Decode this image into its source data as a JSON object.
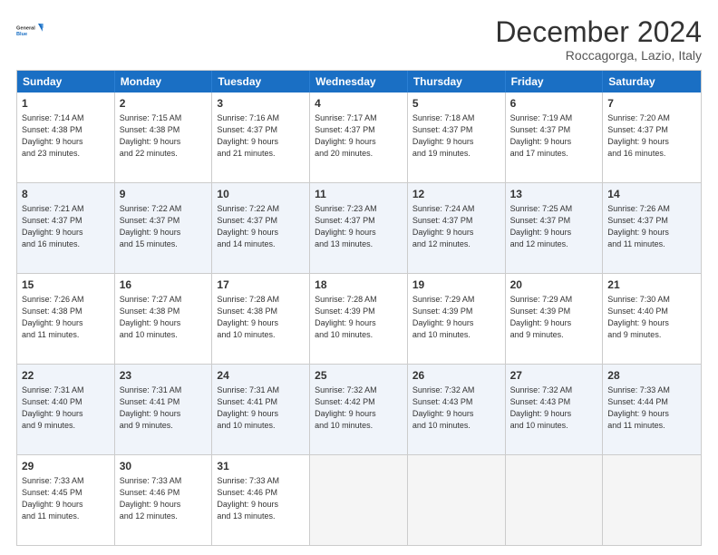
{
  "header": {
    "logo_line1": "General",
    "logo_line2": "Blue",
    "month": "December 2024",
    "location": "Roccagorga, Lazio, Italy"
  },
  "weekdays": [
    "Sunday",
    "Monday",
    "Tuesday",
    "Wednesday",
    "Thursday",
    "Friday",
    "Saturday"
  ],
  "rows": [
    [
      {
        "day": "1",
        "info": "Sunrise: 7:14 AM\nSunset: 4:38 PM\nDaylight: 9 hours\nand 23 minutes."
      },
      {
        "day": "2",
        "info": "Sunrise: 7:15 AM\nSunset: 4:38 PM\nDaylight: 9 hours\nand 22 minutes."
      },
      {
        "day": "3",
        "info": "Sunrise: 7:16 AM\nSunset: 4:37 PM\nDaylight: 9 hours\nand 21 minutes."
      },
      {
        "day": "4",
        "info": "Sunrise: 7:17 AM\nSunset: 4:37 PM\nDaylight: 9 hours\nand 20 minutes."
      },
      {
        "day": "5",
        "info": "Sunrise: 7:18 AM\nSunset: 4:37 PM\nDaylight: 9 hours\nand 19 minutes."
      },
      {
        "day": "6",
        "info": "Sunrise: 7:19 AM\nSunset: 4:37 PM\nDaylight: 9 hours\nand 17 minutes."
      },
      {
        "day": "7",
        "info": "Sunrise: 7:20 AM\nSunset: 4:37 PM\nDaylight: 9 hours\nand 16 minutes."
      }
    ],
    [
      {
        "day": "8",
        "info": "Sunrise: 7:21 AM\nSunset: 4:37 PM\nDaylight: 9 hours\nand 16 minutes."
      },
      {
        "day": "9",
        "info": "Sunrise: 7:22 AM\nSunset: 4:37 PM\nDaylight: 9 hours\nand 15 minutes."
      },
      {
        "day": "10",
        "info": "Sunrise: 7:22 AM\nSunset: 4:37 PM\nDaylight: 9 hours\nand 14 minutes."
      },
      {
        "day": "11",
        "info": "Sunrise: 7:23 AM\nSunset: 4:37 PM\nDaylight: 9 hours\nand 13 minutes."
      },
      {
        "day": "12",
        "info": "Sunrise: 7:24 AM\nSunset: 4:37 PM\nDaylight: 9 hours\nand 12 minutes."
      },
      {
        "day": "13",
        "info": "Sunrise: 7:25 AM\nSunset: 4:37 PM\nDaylight: 9 hours\nand 12 minutes."
      },
      {
        "day": "14",
        "info": "Sunrise: 7:26 AM\nSunset: 4:37 PM\nDaylight: 9 hours\nand 11 minutes."
      }
    ],
    [
      {
        "day": "15",
        "info": "Sunrise: 7:26 AM\nSunset: 4:38 PM\nDaylight: 9 hours\nand 11 minutes."
      },
      {
        "day": "16",
        "info": "Sunrise: 7:27 AM\nSunset: 4:38 PM\nDaylight: 9 hours\nand 10 minutes."
      },
      {
        "day": "17",
        "info": "Sunrise: 7:28 AM\nSunset: 4:38 PM\nDaylight: 9 hours\nand 10 minutes."
      },
      {
        "day": "18",
        "info": "Sunrise: 7:28 AM\nSunset: 4:39 PM\nDaylight: 9 hours\nand 10 minutes."
      },
      {
        "day": "19",
        "info": "Sunrise: 7:29 AM\nSunset: 4:39 PM\nDaylight: 9 hours\nand 10 minutes."
      },
      {
        "day": "20",
        "info": "Sunrise: 7:29 AM\nSunset: 4:39 PM\nDaylight: 9 hours\nand 9 minutes."
      },
      {
        "day": "21",
        "info": "Sunrise: 7:30 AM\nSunset: 4:40 PM\nDaylight: 9 hours\nand 9 minutes."
      }
    ],
    [
      {
        "day": "22",
        "info": "Sunrise: 7:31 AM\nSunset: 4:40 PM\nDaylight: 9 hours\nand 9 minutes."
      },
      {
        "day": "23",
        "info": "Sunrise: 7:31 AM\nSunset: 4:41 PM\nDaylight: 9 hours\nand 9 minutes."
      },
      {
        "day": "24",
        "info": "Sunrise: 7:31 AM\nSunset: 4:41 PM\nDaylight: 9 hours\nand 10 minutes."
      },
      {
        "day": "25",
        "info": "Sunrise: 7:32 AM\nSunset: 4:42 PM\nDaylight: 9 hours\nand 10 minutes."
      },
      {
        "day": "26",
        "info": "Sunrise: 7:32 AM\nSunset: 4:43 PM\nDaylight: 9 hours\nand 10 minutes."
      },
      {
        "day": "27",
        "info": "Sunrise: 7:32 AM\nSunset: 4:43 PM\nDaylight: 9 hours\nand 10 minutes."
      },
      {
        "day": "28",
        "info": "Sunrise: 7:33 AM\nSunset: 4:44 PM\nDaylight: 9 hours\nand 11 minutes."
      }
    ],
    [
      {
        "day": "29",
        "info": "Sunrise: 7:33 AM\nSunset: 4:45 PM\nDaylight: 9 hours\nand 11 minutes."
      },
      {
        "day": "30",
        "info": "Sunrise: 7:33 AM\nSunset: 4:46 PM\nDaylight: 9 hours\nand 12 minutes."
      },
      {
        "day": "31",
        "info": "Sunrise: 7:33 AM\nSunset: 4:46 PM\nDaylight: 9 hours\nand 13 minutes."
      },
      {
        "day": "",
        "info": ""
      },
      {
        "day": "",
        "info": ""
      },
      {
        "day": "",
        "info": ""
      },
      {
        "day": "",
        "info": ""
      }
    ]
  ],
  "alt_rows": [
    1,
    3
  ]
}
